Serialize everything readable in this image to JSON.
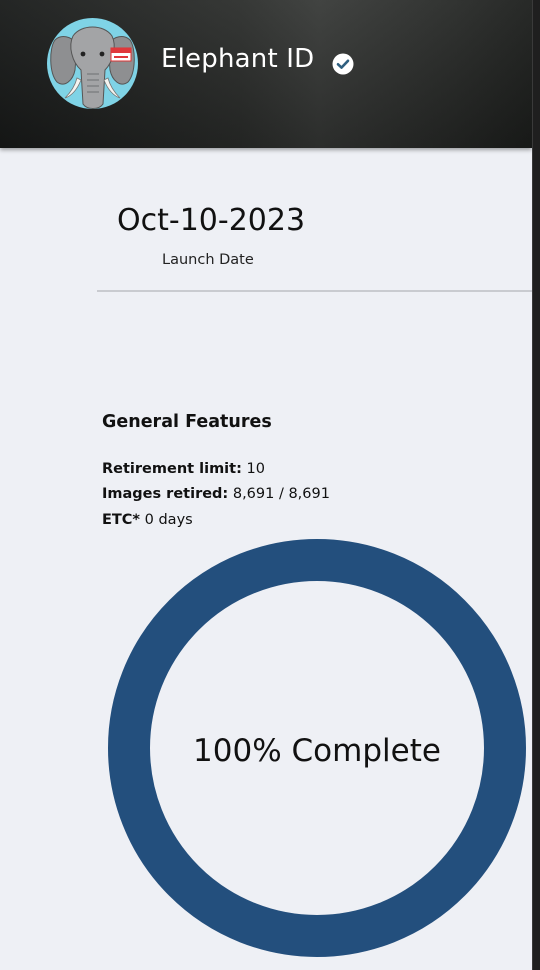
{
  "header": {
    "title": "Elephant ID",
    "avatar_icon": "elephant-avatar-icon",
    "avatar_badge_text": "HELLO",
    "verified_icon": "verified-check-icon",
    "colors": {
      "avatar_bg": "#7fd3e6",
      "verified_bg": "#ffffff",
      "verified_check": "#2f5f7f"
    }
  },
  "launch": {
    "date": "Oct-10-2023",
    "label": "Launch Date"
  },
  "features": {
    "title": "General Features",
    "retirement_limit_label": "Retirement limit:",
    "retirement_limit_value": "10",
    "images_retired_label": "Images retired:",
    "images_retired_value": "8,691 / 8,691",
    "etc_label": "ETC*",
    "etc_value": "0 days"
  },
  "progress": {
    "percent": 100,
    "text": "100% Complete",
    "color": "#234f7d"
  }
}
